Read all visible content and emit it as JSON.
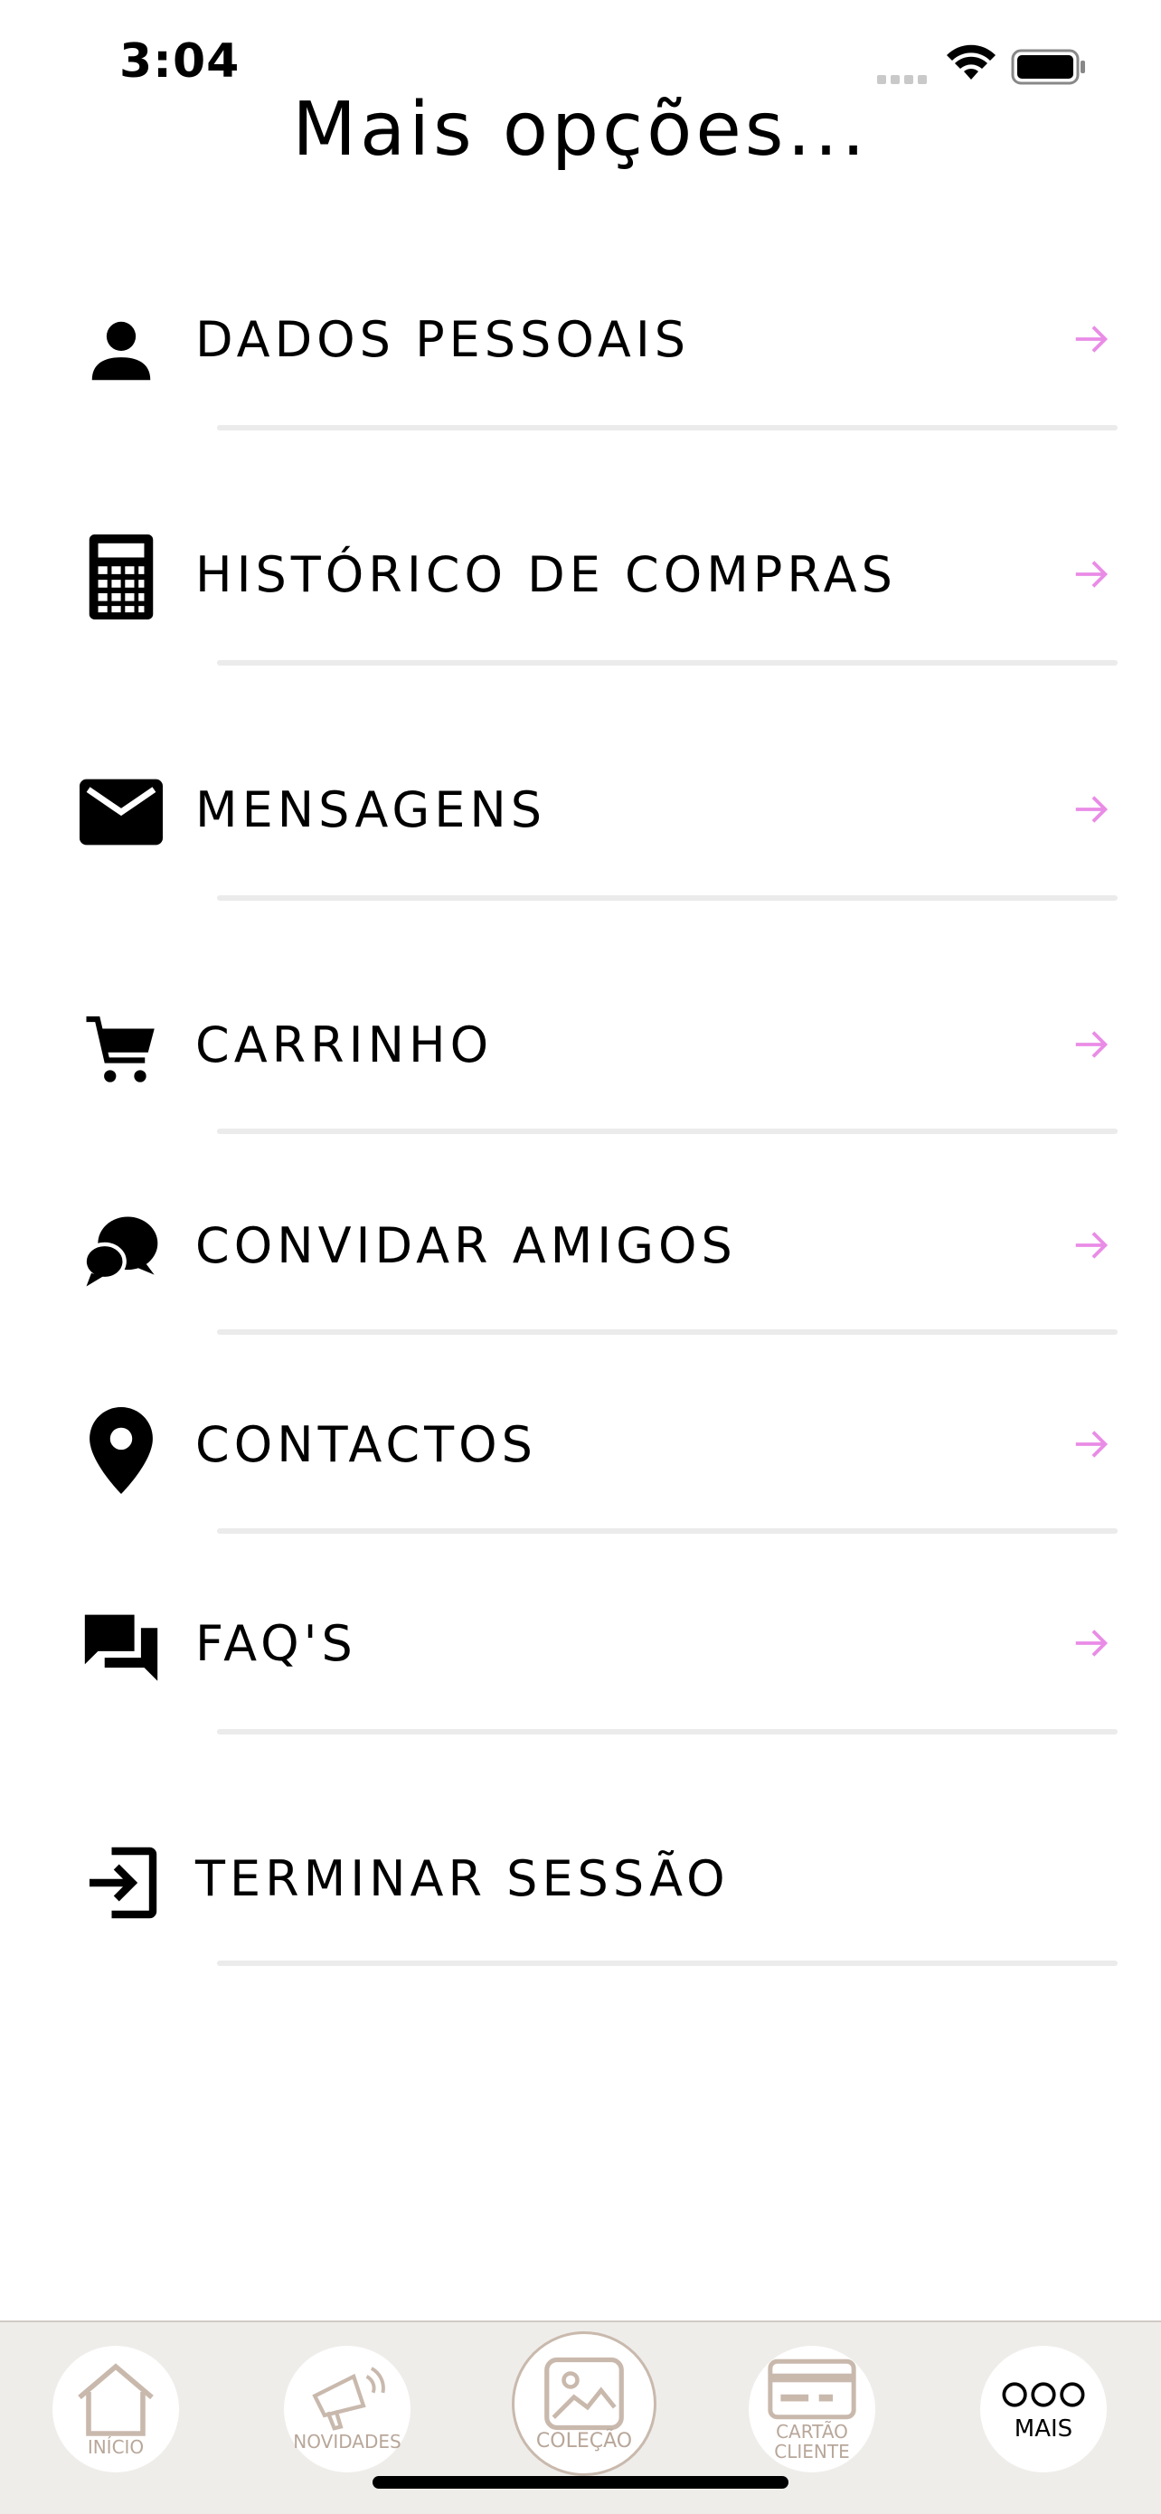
{
  "status_bar": {
    "time": "3:04"
  },
  "page": {
    "title": "Mais opções..."
  },
  "menu": {
    "items": [
      {
        "label": "DADOS PESSOAIS",
        "icon": "person-icon"
      },
      {
        "label": "HISTÓRICO DE COMPRAS",
        "icon": "calculator-icon"
      },
      {
        "label": "MENSAGENS",
        "icon": "mail-icon"
      },
      {
        "label": "CARRINHO",
        "icon": "cart-icon"
      },
      {
        "label": "CONVIDAR AMIGOS",
        "icon": "chat-bubbles-icon"
      },
      {
        "label": "CONTACTOS",
        "icon": "location-pin-icon"
      },
      {
        "label": "FAQ'S",
        "icon": "forum-icon"
      },
      {
        "label": "TERMINAR SESSÃO",
        "icon": "logout-icon"
      }
    ]
  },
  "tab_bar": {
    "tabs": [
      {
        "label": "INÍCIO",
        "icon": "home-icon"
      },
      {
        "label": "NOVIDADES",
        "icon": "megaphone-icon"
      },
      {
        "label": "COLEÇÃO",
        "icon": "image-icon"
      },
      {
        "label_line1": "CARTÃO",
        "label_line2": "CLIENTE",
        "icon": "card-icon"
      },
      {
        "label": "MAIS",
        "icon": "more-icon"
      }
    ]
  },
  "colors": {
    "arrow": "#e98ce6",
    "tab_inactive": "#b8a79a",
    "tab_bar_bg": "#efedea",
    "divider": "#ebebeb"
  }
}
